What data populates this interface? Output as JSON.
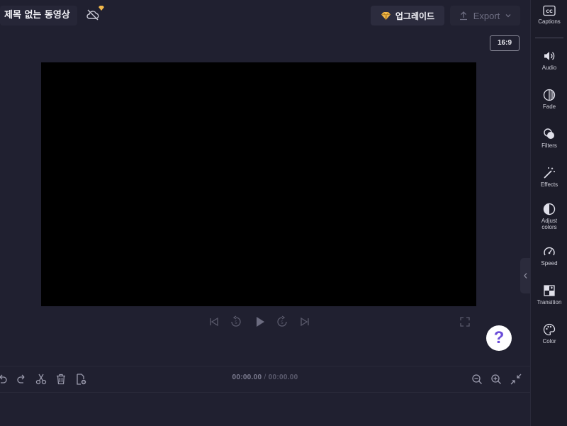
{
  "project": {
    "title": "제목 없는 동영상"
  },
  "toolbar": {
    "upgrade_label": "업그레이드",
    "export_label": "Export",
    "aspect_ratio": "16:9"
  },
  "player": {
    "current_time": "00:00.00",
    "separator": "/",
    "total_time": "00:00.00",
    "help_label": "?"
  },
  "sidebar": {
    "items": [
      {
        "label": "Captions",
        "icon": "cc-icon"
      },
      {
        "label": "Audio",
        "icon": "speaker-icon"
      },
      {
        "label": "Fade",
        "icon": "fade-icon"
      },
      {
        "label": "Filters",
        "icon": "filters-icon"
      },
      {
        "label": "Effects",
        "icon": "magic-wand-icon"
      },
      {
        "label": "Adjust colors",
        "icon": "contrast-icon"
      },
      {
        "label": "Speed",
        "icon": "speedometer-icon"
      },
      {
        "label": "Transition",
        "icon": "transition-icon"
      },
      {
        "label": "Color",
        "icon": "palette-icon"
      }
    ]
  },
  "colors": {
    "background": "#202030",
    "sidebar": "#1c1c29",
    "accent_gem": "#f2b84b",
    "help_mark": "#6a4cd8"
  }
}
